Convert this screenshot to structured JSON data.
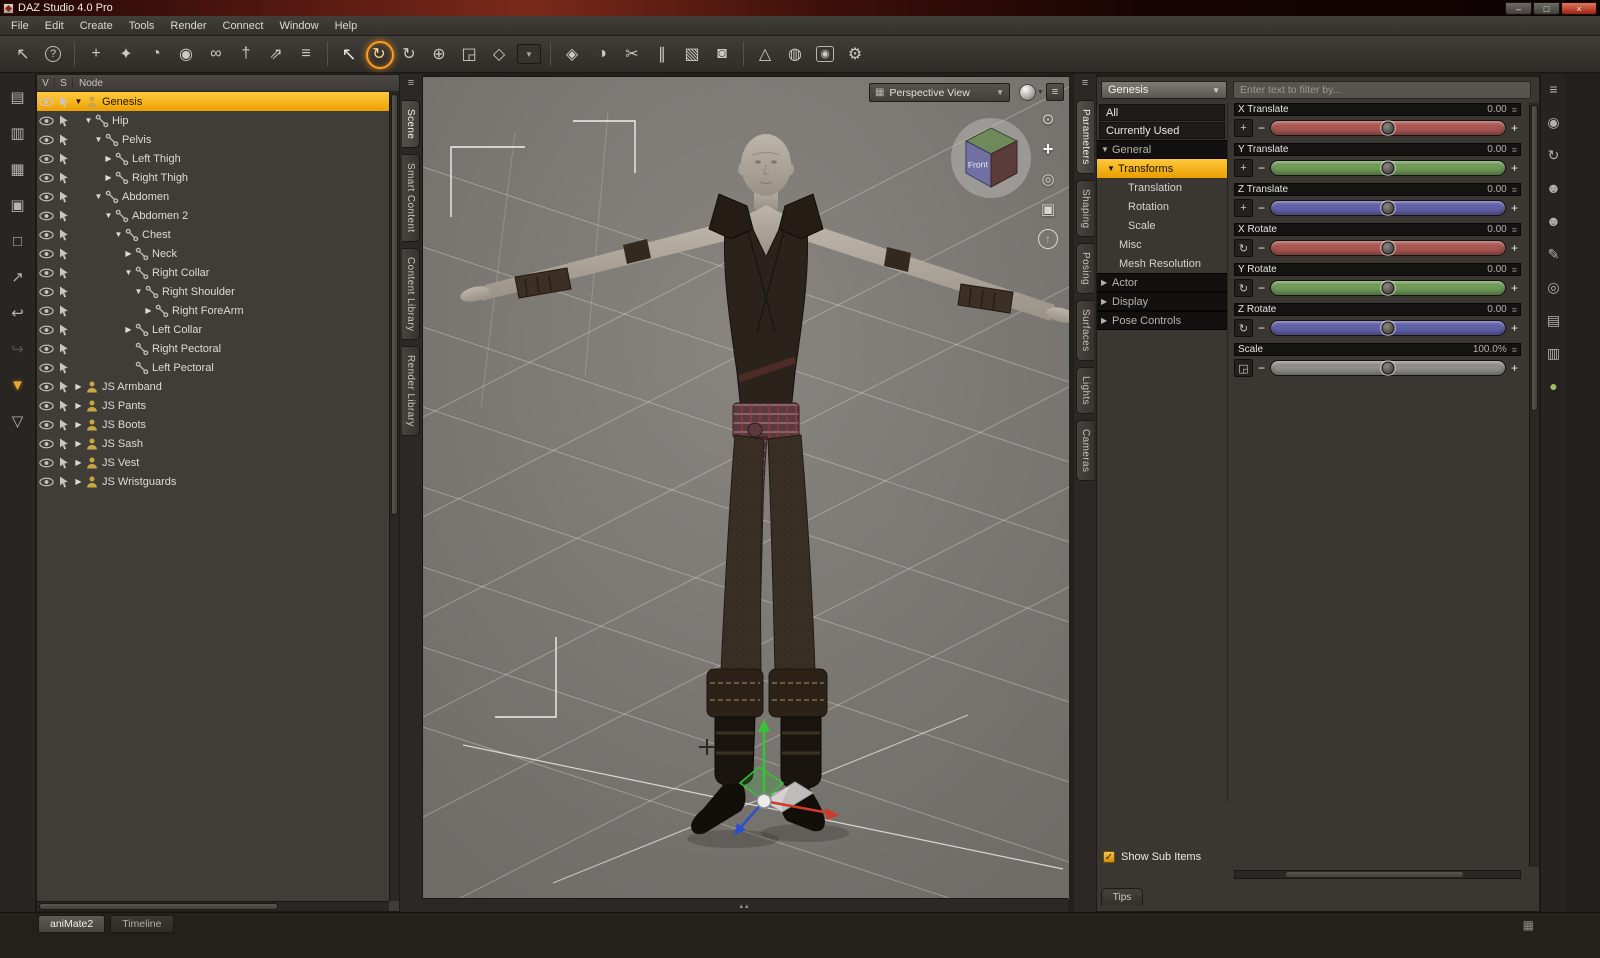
{
  "titlebar": {
    "title": "DAZ Studio 4.0 Pro",
    "minimize": "–",
    "maximize": "□",
    "close": "×"
  },
  "menubar": {
    "items": [
      "File",
      "Edit",
      "Create",
      "Tools",
      "Render",
      "Connect",
      "Window",
      "Help"
    ]
  },
  "toolbar": {
    "icons": [
      {
        "name": "whats-this-icon",
        "glyph": "↖"
      },
      {
        "name": "help-icon",
        "glyph": "?",
        "cls": "circled"
      },
      {
        "sep": true
      },
      {
        "name": "new-node-icon",
        "glyph": "+"
      },
      {
        "name": "burst-node-icon",
        "glyph": "✦"
      },
      {
        "name": "dial-icon",
        "glyph": "◔"
      },
      {
        "name": "compass-icon",
        "glyph": "◉"
      },
      {
        "name": "ik-chain-icon",
        "glyph": "∞"
      },
      {
        "name": "add-bone-icon",
        "glyph": "†"
      },
      {
        "name": "export-bone-icon",
        "glyph": "⇗"
      },
      {
        "name": "bone-list-icon",
        "glyph": "≡"
      },
      {
        "sep": true
      },
      {
        "name": "pointer-tool-icon",
        "glyph": "↖",
        "cls": "big"
      },
      {
        "name": "universal-rotate-tool-icon",
        "glyph": "↻",
        "active": true
      },
      {
        "name": "rotate-tool-icon",
        "glyph": "↻"
      },
      {
        "name": "translate-tool-icon",
        "glyph": "⊕"
      },
      {
        "name": "scale-tool-icon",
        "glyph": "◲"
      },
      {
        "name": "node-edit-tool-icon",
        "glyph": "◇"
      },
      {
        "name": "tool-filter-dropdown-icon",
        "glyph": "▼",
        "cls": "drop"
      },
      {
        "sep": true
      },
      {
        "name": "surface-select-tool-icon",
        "glyph": "◈"
      },
      {
        "name": "figure-pair-icon",
        "glyph": "◑"
      },
      {
        "name": "geometry-edit-icon",
        "glyph": "✂"
      },
      {
        "name": "strand-hair-icon",
        "glyph": "∥"
      },
      {
        "name": "layer-blend-icon",
        "glyph": "▧"
      },
      {
        "name": "render-icon",
        "glyph": "◙"
      },
      {
        "sep": true
      },
      {
        "name": "spot-render-icon",
        "glyph": "△"
      },
      {
        "name": "render-settings-icon",
        "glyph": "◍"
      },
      {
        "name": "camera-icon",
        "glyph": "◉",
        "cls": "boxed"
      },
      {
        "name": "preferences-gear-icon",
        "glyph": "⚙"
      }
    ]
  },
  "left_strip": {
    "icons": [
      {
        "name": "new-file-icon",
        "glyph": "▤"
      },
      {
        "name": "open-file-icon",
        "glyph": "▥"
      },
      {
        "name": "import-icon",
        "glyph": "▦"
      },
      {
        "name": "save-icon",
        "glyph": "▣"
      },
      {
        "name": "save-as-icon",
        "glyph": "□"
      },
      {
        "name": "export-icon",
        "glyph": "↗"
      },
      {
        "name": "undo-icon",
        "glyph": "↩"
      },
      {
        "name": "redo-icon",
        "glyph": "↪",
        "disabled": true
      },
      {
        "name": "download-icon",
        "glyph": "▼",
        "cls": "gold"
      },
      {
        "name": "install-icon",
        "glyph": "▽"
      }
    ]
  },
  "scene_panel": {
    "columns": {
      "v": "V",
      "s": "S",
      "node": "Node"
    },
    "rows": [
      {
        "label": "Genesis",
        "level": 0,
        "arrow": "▼",
        "type": "figure",
        "selected": true
      },
      {
        "label": "Hip",
        "level": 1,
        "arrow": "▼",
        "type": "bone"
      },
      {
        "label": "Pelvis",
        "level": 2,
        "arrow": "▼",
        "type": "bone"
      },
      {
        "label": "Left Thigh",
        "level": 3,
        "arrow": "▶",
        "type": "bone"
      },
      {
        "label": "Right Thigh",
        "level": 3,
        "arrow": "▶",
        "type": "bone"
      },
      {
        "label": "Abdomen",
        "level": 2,
        "arrow": "▼",
        "type": "bone"
      },
      {
        "label": "Abdomen 2",
        "level": 3,
        "arrow": "▼",
        "type": "bone"
      },
      {
        "label": "Chest",
        "level": 4,
        "arrow": "▼",
        "type": "bone"
      },
      {
        "label": "Neck",
        "level": 5,
        "arrow": "▶",
        "type": "bone"
      },
      {
        "label": "Right Collar",
        "level": 5,
        "arrow": "▼",
        "type": "bone"
      },
      {
        "label": "Right Shoulder",
        "level": 6,
        "arrow": "▼",
        "type": "bone"
      },
      {
        "label": "Right ForeArm",
        "level": 7,
        "arrow": "▶",
        "type": "bone"
      },
      {
        "label": "Left Collar",
        "level": 5,
        "arrow": "▶",
        "type": "bone"
      },
      {
        "label": "Right Pectoral",
        "level": 5,
        "arrow": "",
        "type": "bone"
      },
      {
        "label": "Left Pectoral",
        "level": 5,
        "arrow": "",
        "type": "bone"
      },
      {
        "label": "JS Armband",
        "level": 0,
        "arrow": "▶",
        "type": "figure"
      },
      {
        "label": "JS Pants",
        "level": 0,
        "arrow": "▶",
        "type": "figure"
      },
      {
        "label": "JS Boots",
        "level": 0,
        "arrow": "▶",
        "type": "figure"
      },
      {
        "label": "JS Sash",
        "level": 0,
        "arrow": "▶",
        "type": "figure"
      },
      {
        "label": "JS Vest",
        "level": 0,
        "arrow": "▶",
        "type": "figure"
      },
      {
        "label": "JS Wristguards",
        "level": 0,
        "arrow": "▶",
        "type": "figure"
      }
    ]
  },
  "left_tabs": {
    "menu_icon": "≡",
    "tabs": [
      {
        "label": "Scene",
        "active": true
      },
      {
        "label": "Smart Content"
      },
      {
        "label": "Content Library"
      },
      {
        "label": "Render Library"
      }
    ]
  },
  "viewport": {
    "view_selector": "Perspective View",
    "selector_arrow": "▼",
    "grid_icon": "▦",
    "options_icon": "≡",
    "cube_label": "Front",
    "handle": "▴▴",
    "nav_icons": [
      {
        "name": "orbit-icon",
        "glyph": "⊙"
      },
      {
        "name": "pan-icon",
        "glyph": "+",
        "cls": "bright"
      },
      {
        "name": "zoom-icon",
        "glyph": "◎"
      },
      {
        "name": "frame-icon",
        "glyph": "▣"
      },
      {
        "name": "home-icon",
        "glyph": "↑",
        "cls": "circled"
      }
    ]
  },
  "right_tabs": {
    "menu_icon": "≡",
    "tabs": [
      {
        "label": "Parameters",
        "active": true
      },
      {
        "label": "Shaping"
      },
      {
        "label": "Posing"
      },
      {
        "label": "Surfaces"
      },
      {
        "label": "Lights"
      },
      {
        "label": "Cameras"
      }
    ]
  },
  "parameters": {
    "scope": "Genesis",
    "scope_arrow": "▼",
    "filter_placeholder": "Enter text to filter by...",
    "nav": [
      {
        "label": "All",
        "cls": "plain"
      },
      {
        "label": "Currently Used",
        "cls": "plain"
      },
      {
        "label": "General",
        "cls": "section",
        "arrow": "▼"
      },
      {
        "label": "Transforms",
        "cls": "selhdr",
        "arrow": "▼",
        "indent": 6
      },
      {
        "label": "Translation",
        "cls": "sub",
        "indent": 27
      },
      {
        "label": "Rotation",
        "cls": "sub",
        "indent": 27
      },
      {
        "label": "Scale",
        "cls": "sub",
        "indent": 27
      },
      {
        "label": "Misc",
        "cls": "sub",
        "indent": 18
      },
      {
        "label": "Mesh Resolution",
        "cls": "sub",
        "indent": 18
      },
      {
        "label": "Actor",
        "cls": "section",
        "arrow": "▶"
      },
      {
        "label": "Display",
        "cls": "section",
        "arrow": "▶"
      },
      {
        "label": "Pose Controls",
        "cls": "section",
        "arrow": "▶"
      }
    ],
    "sliders": [
      {
        "label": "X Translate",
        "value": "0.00",
        "color": "#a85753",
        "icon": "+",
        "menu_icon": "≡"
      },
      {
        "label": "Y Translate",
        "value": "0.00",
        "color": "#6f9a57",
        "icon": "+",
        "menu_icon": "≡"
      },
      {
        "label": "Z Translate",
        "value": "0.00",
        "color": "#6161a8",
        "icon": "+",
        "menu_icon": "≡"
      },
      {
        "label": "X Rotate",
        "value": "0.00",
        "color": "#a85753",
        "icon": "↻",
        "menu_icon": "≡"
      },
      {
        "label": "Y Rotate",
        "value": "0.00",
        "color": "#6f9a57",
        "icon": "↻",
        "menu_icon": "≡"
      },
      {
        "label": "Z Rotate",
        "value": "0.00",
        "color": "#6161a8",
        "icon": "↻",
        "menu_icon": "≡"
      },
      {
        "label": "Scale",
        "value": "100.0%",
        "color": "#908e8b",
        "icon": "◲",
        "menu_icon": "≡"
      }
    ],
    "show_sub_items": {
      "label": "Show Sub Items",
      "check_glyph": "✓"
    },
    "tips_label": "Tips"
  },
  "right_strip": {
    "icons": [
      {
        "name": "panel-menu-icon",
        "glyph": "≡"
      },
      {
        "name": "info-icon",
        "glyph": "◉"
      },
      {
        "name": "update-swirl-icon",
        "glyph": "↻"
      },
      {
        "name": "figure-icon",
        "glyph": "☻"
      },
      {
        "name": "actor-icon",
        "glyph": "☻"
      },
      {
        "name": "edit-pencil-icon",
        "glyph": "✎"
      },
      {
        "name": "target-icon",
        "glyph": "◎"
      },
      {
        "name": "content-stack-icon",
        "glyph": "▤"
      },
      {
        "name": "library-stack-icon",
        "glyph": "▥"
      },
      {
        "name": "sphere-icon",
        "glyph": "●",
        "cls": "green"
      }
    ]
  },
  "bottom_bar": {
    "tabs": [
      {
        "label": "aniMate2",
        "cls": "light"
      },
      {
        "label": "Timeline",
        "cls": "dim"
      }
    ],
    "corner_icon": "▦"
  }
}
